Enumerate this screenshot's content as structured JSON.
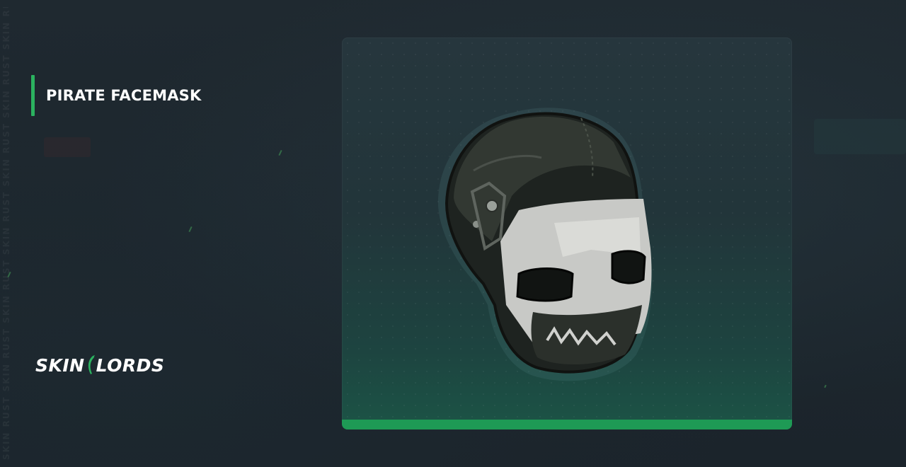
{
  "item": {
    "name": "PIRATE FACEMASK"
  },
  "brand": {
    "logo_left": "SKIN",
    "logo_right": "LORDS"
  },
  "watermark": "SKIN RUST SKIN RUST SKIN RUST SKIN RUST SKIN RUST SKIN RUST SKIN RUST SKIN RUST",
  "colors": {
    "accent": "#2bb25f",
    "card_bottom_bar": "#1e9a55",
    "background": "#1c252c"
  },
  "icons": {
    "item_image": "pirate-facemask-icon",
    "logo_mark": "skinlords-mark-icon"
  }
}
